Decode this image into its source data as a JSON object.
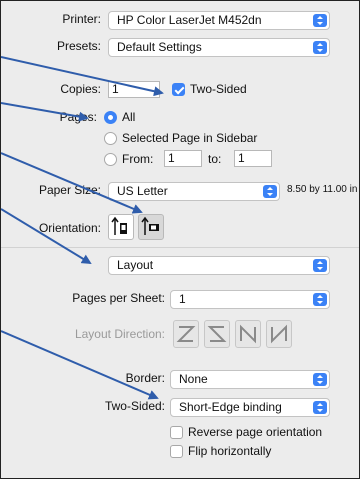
{
  "printer": {
    "label": "Printer:",
    "value": "HP Color LaserJet M452dn"
  },
  "presets": {
    "label": "Presets:",
    "value": "Default Settings"
  },
  "copies": {
    "label": "Copies:",
    "value": "1",
    "two_sided_label": "Two-Sided",
    "two_sided_checked": true
  },
  "pages": {
    "label": "Pages:",
    "all_label": "All",
    "selected_label": "Selected Page in Sidebar",
    "from_label": "From:",
    "from_value": "1",
    "to_label": "to:",
    "to_value": "1",
    "selected_option": "All"
  },
  "paper_size": {
    "label": "Paper Size:",
    "value": "US Letter",
    "dimensions": "8.50 by 11.00 in"
  },
  "orientation": {
    "label": "Orientation:",
    "selected": "landscape"
  },
  "section_menu": {
    "value": "Layout"
  },
  "layout": {
    "pages_per_sheet_label": "Pages per Sheet:",
    "pages_per_sheet_value": "1",
    "layout_direction_label": "Layout Direction:",
    "border_label": "Border:",
    "border_value": "None",
    "two_sided_label": "Two-Sided:",
    "two_sided_value": "Short-Edge binding",
    "reverse_label": "Reverse page orientation",
    "reverse_checked": false,
    "flip_label": "Flip horizontally",
    "flip_checked": false
  },
  "colors": {
    "accent": "#3b82f6",
    "annotation": "#2f5dab",
    "background": "#ececec"
  }
}
